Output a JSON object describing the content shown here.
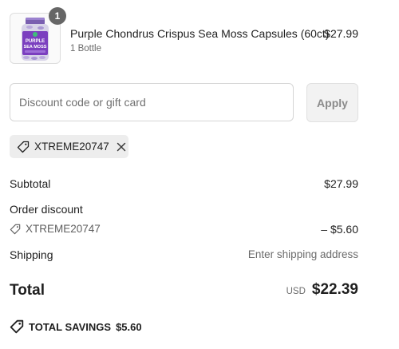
{
  "cart": {
    "item": {
      "name": "Purple Chondrus Crispus Sea Moss Capsules (60ct)",
      "variant": "1 Bottle",
      "price": "$27.99",
      "quantity": "1",
      "thumbnail_icon": "supplement-bottle-image",
      "label_lines": [
        "PURPLE",
        "SEA MOSS"
      ]
    }
  },
  "discount": {
    "placeholder": "Discount code or gift card",
    "value": "",
    "apply_label": "Apply",
    "applied_code": "XTREME20747"
  },
  "summary": {
    "subtotal_label": "Subtotal",
    "subtotal_value": "$27.99",
    "order_discount_label": "Order discount",
    "discount_code": "XTREME20747",
    "discount_value": "– $5.60",
    "shipping_label": "Shipping",
    "shipping_value": "Enter shipping address",
    "total_label": "Total",
    "total_currency": "USD",
    "total_value": "$22.39",
    "savings_label": "TOTAL SAVINGS",
    "savings_value": "$5.60"
  },
  "colors": {
    "text": "#1f1f1f",
    "muted": "#6b6b6b",
    "badge": "#666666",
    "tag_bg": "#ededed",
    "bottle_purple": "#7b3fbf"
  }
}
